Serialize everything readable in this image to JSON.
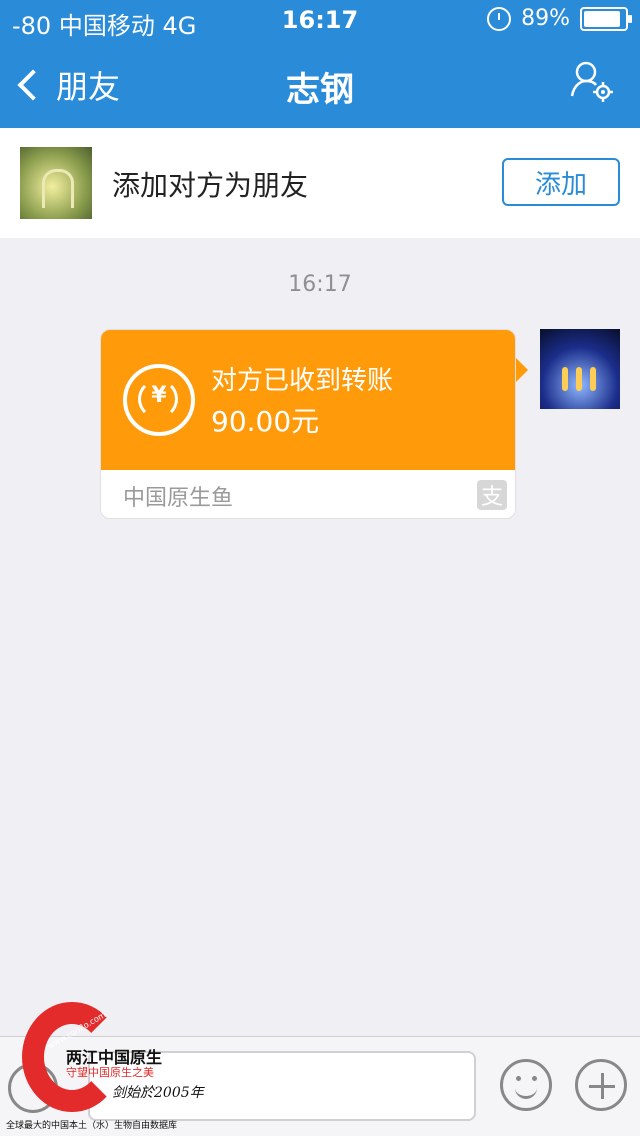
{
  "status_bar": {
    "carrier": "-80 中国移动  4G",
    "time": "16:17",
    "battery": "89%",
    "battery_level": 0.89
  },
  "nav": {
    "back_label": "朋友",
    "title": "志钢"
  },
  "add_friend": {
    "prompt": "添加对方为朋友",
    "button": "添加"
  },
  "chat": {
    "timestamp": "16:17",
    "transfer": {
      "currency_symbol": "¥",
      "status": "对方已收到转账",
      "amount": "90.00元",
      "source": "中国原生鱼",
      "brand_icon_char": "支"
    }
  },
  "input_bar": {
    "icons": [
      "voice-icon",
      "emoji-icon",
      "plus-icon"
    ]
  },
  "watermark": {
    "title": "两江中国原生",
    "slogan": "守望中国原生之美",
    "signature": "剑始於2005年",
    "url": "www.cqn2o.com",
    "footer": "全球最大的中国本土（水）生物自由数据库"
  },
  "colors": {
    "accent_blue": "#2a8bd8",
    "transfer_orange": "#ff9a0a",
    "background": "#efeff4",
    "watermark_red": "#e32b2b"
  }
}
